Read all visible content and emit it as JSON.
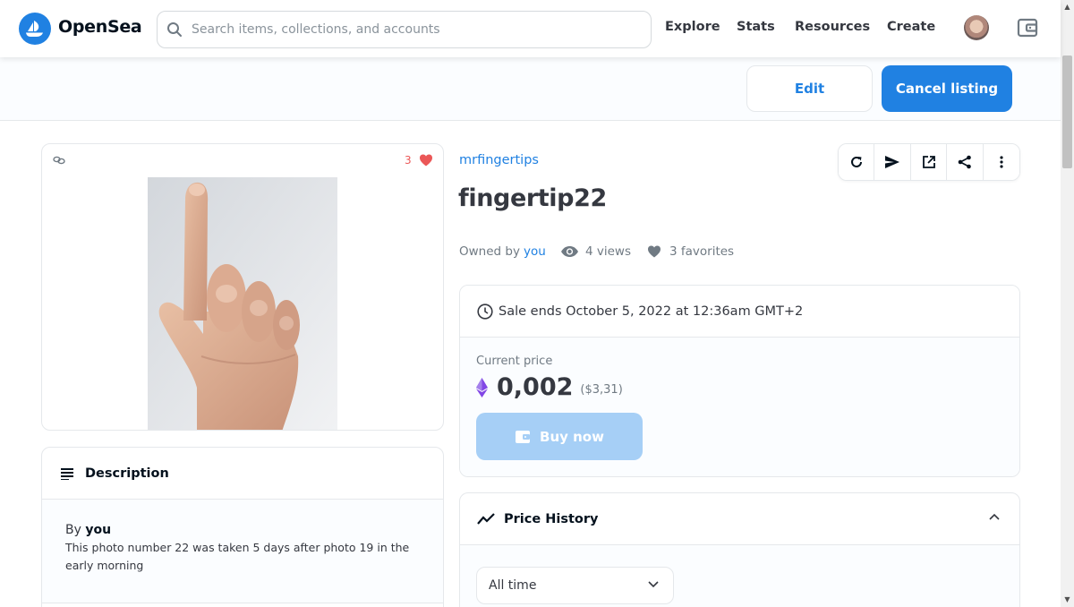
{
  "nav": {
    "brand": "OpenSea",
    "search_placeholder": "Search items, collections, and accounts",
    "links": [
      "Explore",
      "Stats",
      "Resources",
      "Create"
    ]
  },
  "owner_bar": {
    "edit_label": "Edit",
    "cancel_label": "Cancel listing"
  },
  "asset": {
    "favorite_count": "3",
    "collection": "mrfingertips",
    "name": "fingertip22",
    "owned_by_label": "Owned by",
    "owner": "you",
    "views": "4 views",
    "favorites": "3 favorites"
  },
  "description": {
    "title": "Description",
    "by_label": "By",
    "by_user": "you",
    "text": "This photo number 22 was taken 5 days after photo 19 in the early morning"
  },
  "sale": {
    "ends_text": "Sale ends October 5, 2022 at 12:36am GMT+2",
    "current_price_label": "Current price",
    "price": "0,002",
    "usd": "($3,31)",
    "buy_label": "Buy now"
  },
  "price_history": {
    "title": "Price History",
    "range_selected": "All time"
  },
  "colors": {
    "accent": "#2081e2",
    "heart": "#eb5757",
    "eth": "#8247e5"
  }
}
